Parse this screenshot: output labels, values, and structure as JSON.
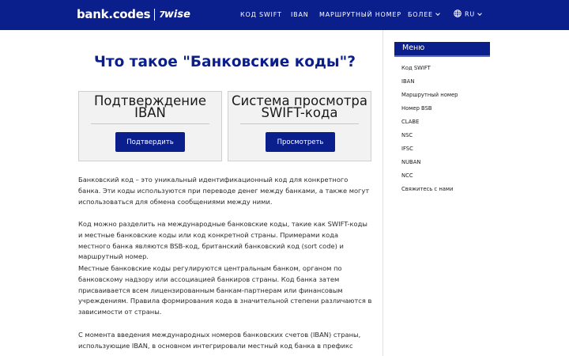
{
  "header": {
    "logo_bank": "bank.codes",
    "logo_wise": "wise",
    "logo_wise_mark": "7",
    "nav": [
      "Код SWIFT",
      "IBAN",
      "Маршрутный номер",
      "Более"
    ],
    "language": "RU"
  },
  "main": {
    "title": "Что такое \"Банковские коды\"?",
    "cards": [
      {
        "title": "Подтверждение IBAN",
        "button": "Подтвердить"
      },
      {
        "title": "Система просмотра SWIFT-кода",
        "button": "Просмотреть"
      }
    ],
    "paragraphs": [
      "Банковский код – это уникальный идентификационный код для конкретного банка. Эти коды используются при переводе денег между банками, а также могут использоваться для обмена сообщениями между ними.",
      "Код можно разделить на международные банковские коды, такие как SWIFT-коды и местные банковские коды или код конкретной страны. Примерами кода местного банка являются BSB-код, британский банковский код (sort code) и маршрутный номер.",
      "Местные банковские коды регулируются центральным банком, органом по банковскому надзору или ассоциацией банкиров страны. Код банка затем присваивается всем лицензированным банкам-партнерам или финансовым учреждениям. Правила формирования кода в значительной степени различаются в зависимости от страны.",
      "С момента введения международных номеров банковских счетов (IBAN) страны, использующие IBAN, в основном интегрировали местный код банка в префикс"
    ]
  },
  "sidebar": {
    "title": "Меню",
    "items": [
      "Код SWIFT",
      "IBAN",
      "Маршрутный номер",
      "Номер BSB",
      "CLABE",
      "NSC",
      "IFSC",
      "NUBAN",
      "NCC",
      "Свяжитесь с нами"
    ]
  },
  "colors": {
    "brand": "#0a1e8c",
    "card_bg": "#f2f2f2",
    "text": "#2a2a2a"
  },
  "icons": {
    "language": "globe-icon",
    "dropdown": "chevron-down-icon"
  }
}
